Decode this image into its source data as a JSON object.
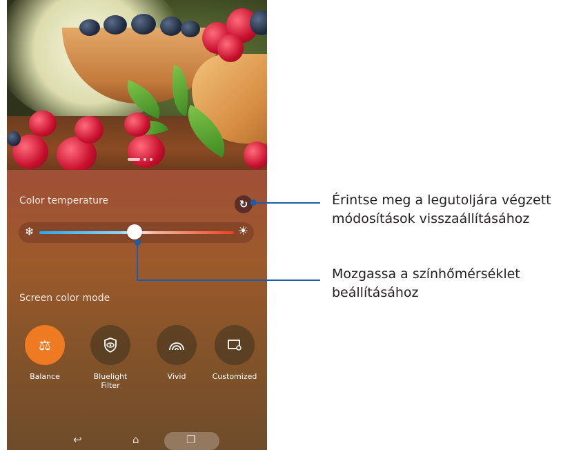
{
  "screen": {
    "color_temperature_label": "Color temperature",
    "screen_color_mode_label": "Screen color mode",
    "slider_value_percent": 49,
    "accent_color": "#ee7a22",
    "modes": [
      {
        "label": "Balance",
        "icon": "balance-scale-icon",
        "active": true
      },
      {
        "label": "Bluelight Filter",
        "icon": "eye-shield-icon",
        "active": false
      },
      {
        "label": "Vivid",
        "icon": "wifi-rainbow-icon",
        "active": false
      },
      {
        "label": "Customized",
        "icon": "screen-settings-icon",
        "active": false
      }
    ]
  },
  "callouts": {
    "reset": "Érintse meg a legutoljára végzett módosítások visszaállításához",
    "slider": "Mozgassa a színhőmérséklet beállításához"
  }
}
